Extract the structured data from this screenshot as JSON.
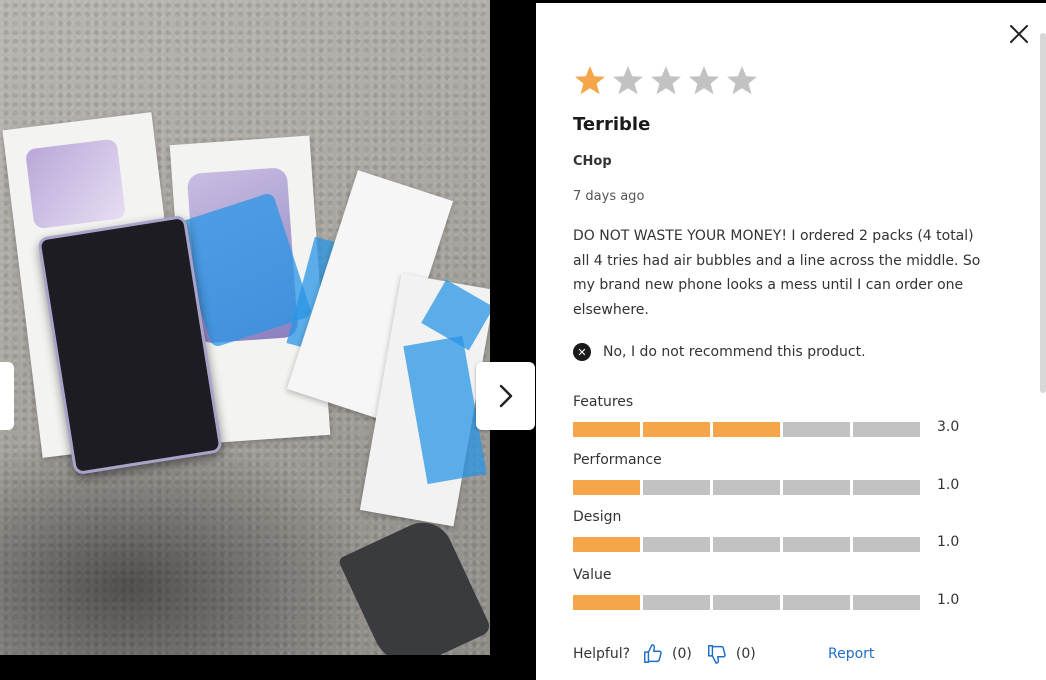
{
  "review": {
    "rating": 1,
    "max_rating": 5,
    "title": "Terrible",
    "author": "CHop",
    "date": "7 days ago",
    "body": "DO NOT WASTE YOUR MONEY! I ordered 2 packs (4 total) all 4 tries had air bubbles and a line across the middle. So my brand new phone looks a mess until I can order one elsewhere.",
    "recommendation": "No, I do not recommend this product."
  },
  "metrics": [
    {
      "label": "Features",
      "value_text": "3.0",
      "value": 3,
      "max": 5
    },
    {
      "label": "Performance",
      "value_text": "1.0",
      "value": 1,
      "max": 5
    },
    {
      "label": "Design",
      "value_text": "1.0",
      "value": 1,
      "max": 5
    },
    {
      "label": "Value",
      "value_text": "1.0",
      "value": 1,
      "max": 5
    }
  ],
  "helpful": {
    "label": "Helpful?",
    "yes_count": "(0)",
    "no_count": "(0)",
    "report_label": "Report"
  },
  "icons": {
    "close": "close-icon",
    "next": "chevron-right-icon",
    "prev": "chevron-left-icon",
    "not_recommend": "x-circle-icon",
    "thumbs_up": "thumbs-up-icon",
    "thumbs_down": "thumbs-down-icon",
    "star": "star-icon"
  },
  "colors": {
    "star_filled": "#F6A64A",
    "star_empty": "#C2C2C2",
    "bar_filled": "#F6A64A",
    "bar_empty": "#C2C2C2",
    "link": "#1F6EC4",
    "thumb": "#1F6EC4"
  }
}
